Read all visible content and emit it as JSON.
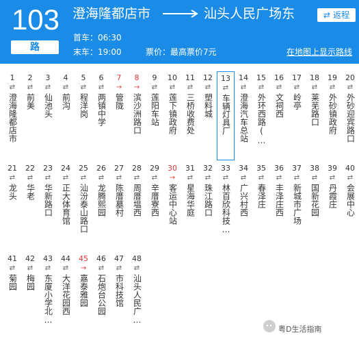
{
  "header": {
    "route_number": "103",
    "route_suffix": "路",
    "from_station": "澄海隆都店市",
    "to_station": "汕头人民广场东",
    "back_label": "返程",
    "back_icon": "swap-icon",
    "first_bus_label": "首车：06:30",
    "last_bus_label": "末车：19:00",
    "fare_label": "票价：最高票价7元",
    "map_link_label": "在地图上显示路线"
  },
  "colors": {
    "header_bg": "#1a8ce8",
    "one_way_red": "#e4393c",
    "highlight_border": "#1a8ce8"
  },
  "stops": [
    {
      "n": "1",
      "dir": "⇄",
      "name": "澄海隆都店市"
    },
    {
      "n": "2",
      "dir": "⇄",
      "name": "前美"
    },
    {
      "n": "3",
      "dir": "⇄",
      "name": "仙池头"
    },
    {
      "n": "4",
      "dir": "⇄",
      "name": "前沟"
    },
    {
      "n": "5",
      "dir": "⇄",
      "name": "程洋岗"
    },
    {
      "n": "6",
      "dir": "⇄",
      "name": "两镇中学"
    },
    {
      "n": "7",
      "dir": "→",
      "name": "管陇",
      "one_way": true
    },
    {
      "n": "8",
      "dir": "→",
      "name": "滨沙洲路口",
      "one_way": true
    },
    {
      "n": "9",
      "dir": "⇄",
      "name": "莲阳车站"
    },
    {
      "n": "10",
      "dir": "⇄",
      "name": "莲下镇政府"
    },
    {
      "n": "11",
      "dir": "⇄",
      "name": "三桥收费处"
    },
    {
      "n": "12",
      "dir": "⇄",
      "name": "塑料城"
    },
    {
      "n": "13",
      "dir": "⇄",
      "name": "车辆灯具厂",
      "current": true
    },
    {
      "n": "14",
      "dir": "⇄",
      "name": "澄海汽车总站"
    },
    {
      "n": "15",
      "dir": "⇄",
      "name": "外环西路(…"
    },
    {
      "n": "16",
      "dir": "⇄",
      "name": "文祠西"
    },
    {
      "n": "17",
      "dir": "⇄",
      "name": "岭亭"
    },
    {
      "n": "18",
      "dir": "⇄",
      "name": "莱芜路口"
    },
    {
      "n": "19",
      "dir": "⇄",
      "name": "外砂镇政府"
    },
    {
      "n": "20",
      "dir": "⇄",
      "name": "外砂迎宾路口"
    },
    {
      "n": "21",
      "dir": "⇄",
      "name": "龙头"
    },
    {
      "n": "22",
      "dir": "⇄",
      "name": "华老"
    },
    {
      "n": "23",
      "dir": "⇄",
      "name": "华新路口"
    },
    {
      "n": "24",
      "dir": "⇄",
      "name": "正大体育馆"
    },
    {
      "n": "25",
      "dir": "⇄",
      "name": "汕汾泰山路口"
    },
    {
      "n": "26",
      "dir": "⇄",
      "name": "龙腾熙园"
    },
    {
      "n": "27",
      "dir": "⇄",
      "name": "陈厝墓村"
    },
    {
      "n": "28",
      "dir": "⇄",
      "name": "周厝塭西"
    },
    {
      "n": "29",
      "dir": "⇄",
      "name": "辛厝寮西"
    },
    {
      "n": "30",
      "dir": "→",
      "name": "客运中心站",
      "one_way": true
    },
    {
      "n": "31",
      "dir": "⇄",
      "name": "星海华庭"
    },
    {
      "n": "32",
      "dir": "⇄",
      "name": "珠江路口"
    },
    {
      "n": "33",
      "dir": "⇄",
      "name": "林百欣科技…"
    },
    {
      "n": "34",
      "dir": "⇄",
      "name": "广兴村西"
    },
    {
      "n": "35",
      "dir": "⇄",
      "name": "春泽庄"
    },
    {
      "n": "36",
      "dir": "⇄",
      "name": "丰泽庄西"
    },
    {
      "n": "37",
      "dir": "⇄",
      "name": "新城市广场"
    },
    {
      "n": "38",
      "dir": "⇄",
      "name": "国新花园"
    },
    {
      "n": "39",
      "dir": "⇄",
      "name": "丹霞庄"
    },
    {
      "n": "40",
      "dir": "⇄",
      "name": "会展中心"
    },
    {
      "n": "41",
      "dir": "⇄",
      "name": "菊园"
    },
    {
      "n": "42",
      "dir": "⇄",
      "name": "梅园"
    },
    {
      "n": "43",
      "dir": "⇄",
      "name": "东厦小学北…"
    },
    {
      "n": "44",
      "dir": "⇄",
      "name": "大洋花园西"
    },
    {
      "n": "45",
      "dir": "→",
      "name": "嘉泰雅园",
      "one_way": true
    },
    {
      "n": "46",
      "dir": "⇄",
      "name": "石炮台公园"
    },
    {
      "n": "47",
      "dir": "⇄",
      "name": "市科技馆"
    },
    {
      "n": "48",
      "dir": "⇄",
      "name": "汕头人民广…"
    }
  ],
  "watermark": {
    "text": "粤D生活指南",
    "icon": "wechat-icon"
  }
}
